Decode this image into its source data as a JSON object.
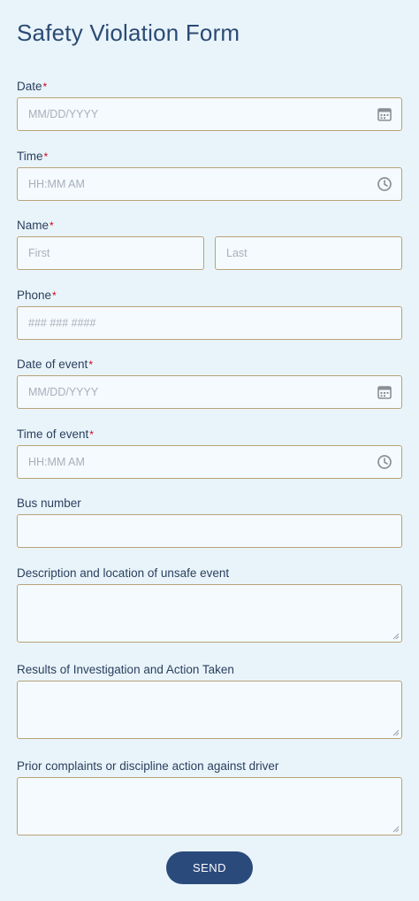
{
  "form": {
    "title": "Safety Violation Form",
    "required_mark": "*",
    "date": {
      "label": "Date",
      "placeholder": "MM/DD/YYYY"
    },
    "time": {
      "label": "Time",
      "placeholder": "HH:MM AM"
    },
    "name": {
      "label": "Name",
      "first_placeholder": "First",
      "last_placeholder": "Last"
    },
    "phone": {
      "label": "Phone",
      "placeholder": "### ### ####"
    },
    "date_of_event": {
      "label": "Date of event",
      "placeholder": "MM/DD/YYYY"
    },
    "time_of_event": {
      "label": "Time of event",
      "placeholder": "HH:MM AM"
    },
    "bus_number": {
      "label": "Bus number"
    },
    "description": {
      "label": "Description and location of unsafe event"
    },
    "results": {
      "label": "Results of Investigation and Action Taken"
    },
    "prior": {
      "label": "Prior complaints or discipline action against driver"
    },
    "send_label": "SEND"
  },
  "colors": {
    "accent": "#2b4a7c",
    "required": "#d0021b",
    "border": "#b9a27a",
    "background": "#e9f4fa"
  },
  "icons": {
    "date": "calendar-icon",
    "time": "clock-icon"
  }
}
